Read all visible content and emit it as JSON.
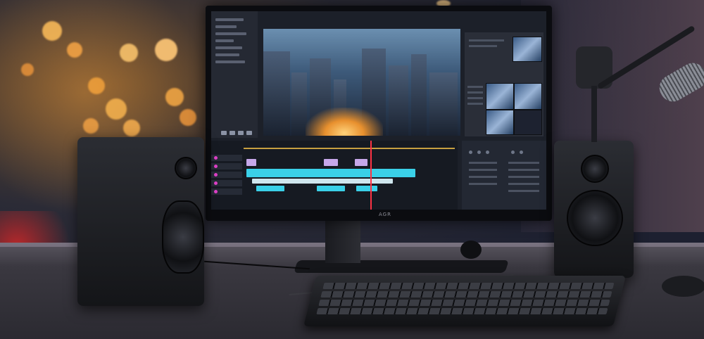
{
  "scene": {
    "brand_text": "AGR"
  },
  "colors": {
    "clip_cyan": "#3ad0e8",
    "clip_purple": "#c6a8ea",
    "playhead": "#ff3344",
    "bokeh_warm": "#ffb347"
  },
  "icons": [
    "speaker-icon",
    "microphone-icon",
    "keyboard-icon",
    "monitor-icon"
  ]
}
